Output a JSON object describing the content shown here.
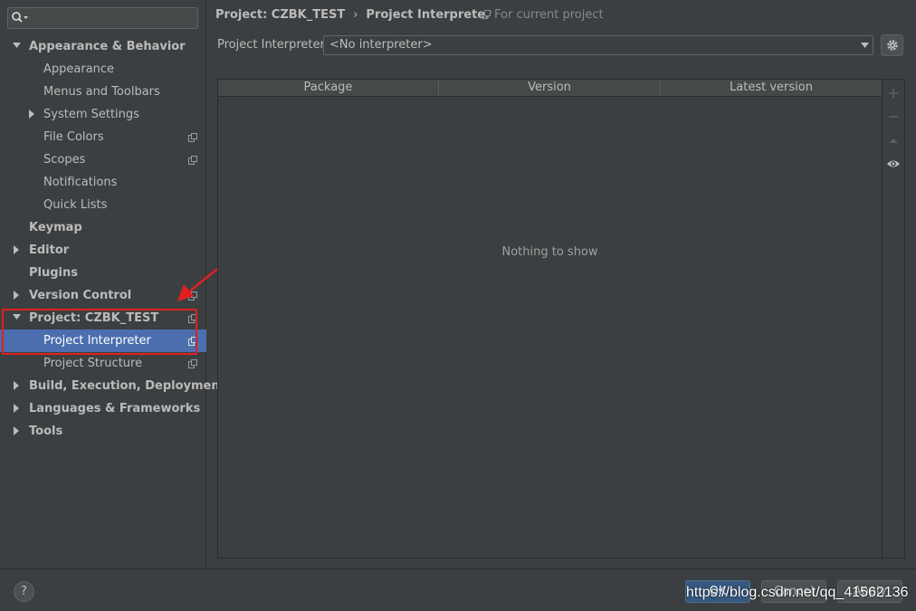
{
  "search": {
    "placeholder": ""
  },
  "tree": [
    {
      "label": "Appearance & Behavior",
      "level": 0,
      "expanded": true,
      "bold": true,
      "arrow": "down"
    },
    {
      "label": "Appearance",
      "level": 1
    },
    {
      "label": "Menus and Toolbars",
      "level": 1
    },
    {
      "label": "System Settings",
      "level": 1,
      "arrow": "right"
    },
    {
      "label": "File Colors",
      "level": 1,
      "icon": true
    },
    {
      "label": "Scopes",
      "level": 1,
      "icon": true
    },
    {
      "label": "Notifications",
      "level": 1
    },
    {
      "label": "Quick Lists",
      "level": 1
    },
    {
      "label": "Keymap",
      "level": 0,
      "bold": true
    },
    {
      "label": "Editor",
      "level": 0,
      "bold": true,
      "arrow": "right"
    },
    {
      "label": "Plugins",
      "level": 0,
      "bold": true
    },
    {
      "label": "Version Control",
      "level": 0,
      "bold": true,
      "arrow": "right",
      "icon": true
    },
    {
      "label": "Project: CZBK_TEST",
      "level": 0,
      "bold": true,
      "arrow": "down",
      "icon": true
    },
    {
      "label": "Project Interpreter",
      "level": 1,
      "icon": true,
      "selected": true
    },
    {
      "label": "Project Structure",
      "level": 1,
      "icon": true
    },
    {
      "label": "Build, Execution, Deployment",
      "level": 0,
      "bold": true,
      "arrow": "right"
    },
    {
      "label": "Languages & Frameworks",
      "level": 0,
      "bold": true,
      "arrow": "right"
    },
    {
      "label": "Tools",
      "level": 0,
      "bold": true,
      "arrow": "right"
    }
  ],
  "breadcrumb": {
    "parent": "Project: CZBK_TEST",
    "separator": "›",
    "current": "Project Interpreter"
  },
  "scope_note": "For current project",
  "interpreter": {
    "label": "Project Interpreter:",
    "value": "<No interpreter>"
  },
  "table": {
    "columns": [
      "Package",
      "Version",
      "Latest version"
    ],
    "empty_text": "Nothing to show"
  },
  "footer": {
    "help": "?",
    "ok": "OK",
    "cancel": "Cancel",
    "apply": "Apply"
  },
  "watermark": "https://blog.csdn.net/qq_41562136",
  "colors": {
    "selection": "#4b6eaf",
    "annotation": "#e02020",
    "background": "#3c3f41"
  }
}
